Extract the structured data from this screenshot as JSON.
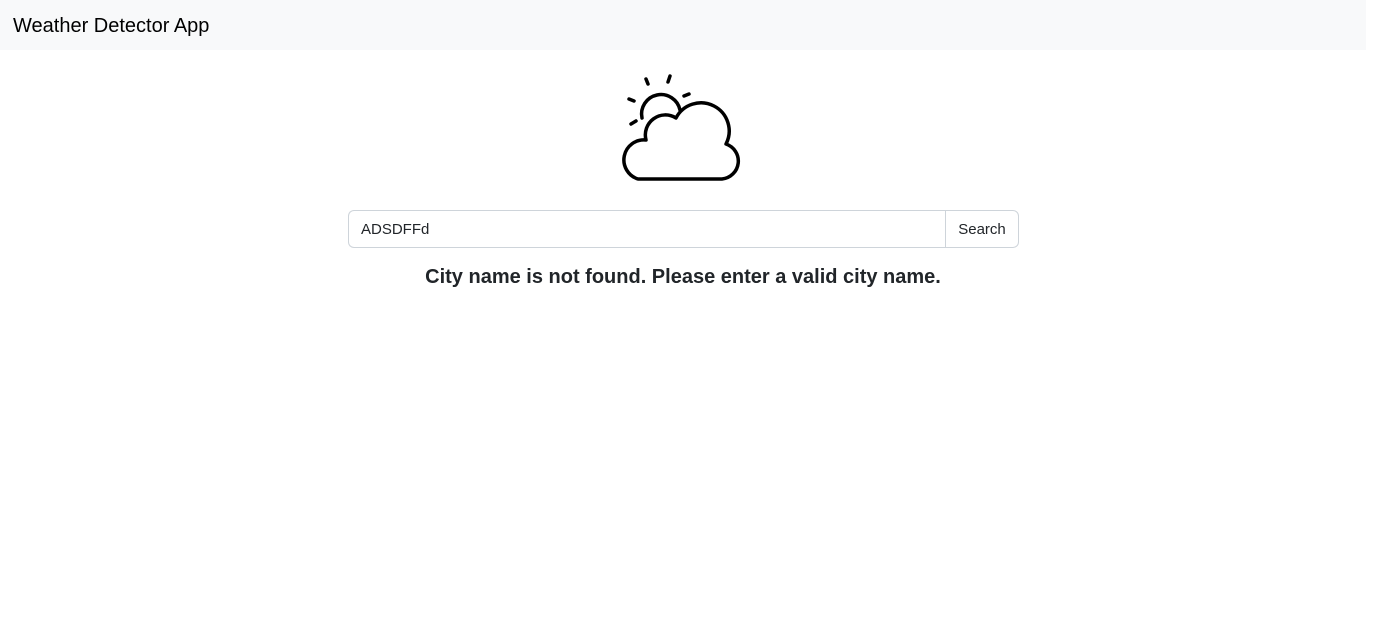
{
  "navbar": {
    "brand": "Weather Detector App"
  },
  "icon": {
    "name": "partly-cloudy-icon"
  },
  "search": {
    "value": "ADSDFFd",
    "placeholder": "",
    "button_label": "Search"
  },
  "result": {
    "message": "City name is not found. Please enter a valid city name."
  },
  "colors": {
    "navbar_bg": "#f8f9fa",
    "border": "#ced4da",
    "text": "#212529"
  }
}
